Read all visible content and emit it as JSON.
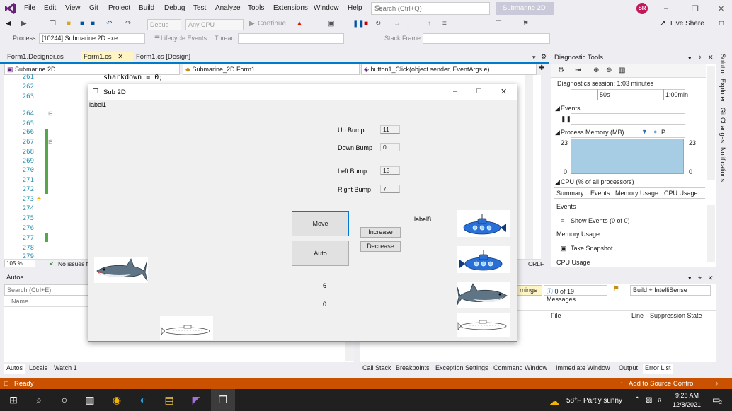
{
  "menu": [
    "File",
    "Edit",
    "View",
    "Git",
    "Project",
    "Build",
    "Debug",
    "Test",
    "Analyze",
    "Tools",
    "Extensions",
    "Window",
    "Help"
  ],
  "search": {
    "placeholder": "Search (Ctrl+Q)"
  },
  "solution_name": "Submarine 2D",
  "user_initials": "SR",
  "toolbar": {
    "config": "Debug",
    "platform": "Any CPU",
    "continue": "Continue",
    "live_share": "Live Share"
  },
  "toolbar2": {
    "process_label": "Process:",
    "process_value": "[10244] Submarine 2D.exe",
    "lifecycle": "Lifecycle Events",
    "thread_label": "Thread:",
    "stack_frame_label": "Stack Frame:"
  },
  "doc_tabs": [
    {
      "label": "Form1.Designer.cs"
    },
    {
      "label": "Form1.cs"
    },
    {
      "label": "Form1.cs [Design]"
    }
  ],
  "nav": {
    "project": "Submarine 2D",
    "class": "Submarine_2D.Form1",
    "member": "button1_Click(object sender, EventArgs e)"
  },
  "editor": {
    "code_line": "sharkdown = 0;",
    "line_numbers": [
      "261",
      "262",
      "263",
      "264",
      "265",
      "266",
      "267",
      "268",
      "269",
      "270",
      "271",
      "272",
      "273",
      "274",
      "275",
      "276",
      "277",
      "278",
      "279"
    ],
    "zoom": "105 %",
    "issues": "No issues f",
    "line_ending": "CRLF"
  },
  "diagnostics": {
    "title": "Diagnostic Tools",
    "session": "Diagnostics session: 1:03 minutes",
    "tick1": "50s",
    "tick2": "1:00min",
    "events_label": "Events",
    "memory_label": "Process Memory (MB)",
    "memory_legend": "P.",
    "mem_max_left": "23",
    "mem_max_right": "23",
    "mem_min_left": "0",
    "mem_min_right": "0",
    "cpu_label": "CPU (% of all processors)",
    "tabs": [
      "Summary",
      "Events",
      "Memory Usage",
      "CPU Usage"
    ],
    "sec_events": "Events",
    "show_events": "Show Events (0 of 0)",
    "sec_memory": "Memory Usage",
    "take_snapshot": "Take Snapshot",
    "sec_cpu": "CPU Usage"
  },
  "side_tabs": [
    "Solution Explorer",
    "Git Changes",
    "Notifications"
  ],
  "autos": {
    "title": "Autos",
    "search": "Search (Ctrl+E)",
    "col_name": "Name"
  },
  "errlist": {
    "warnings": "rnings",
    "messages": "0 of 19 Messages",
    "build_filter": "Build + IntelliSense",
    "col_file": "File",
    "col_line": "Line",
    "col_suppression": "Suppression State"
  },
  "bottom_tabs_left": [
    "Autos",
    "Locals",
    "Watch 1"
  ],
  "bottom_tabs_right": [
    "Call Stack",
    "Breakpoints",
    "Exception Settings",
    "Command Window",
    "Immediate Window",
    "Output",
    "Error List"
  ],
  "status": {
    "ready": "Ready",
    "source_control": "Add to Source Control"
  },
  "taskbar": {
    "weather": "58°F  Partly sunny",
    "time": "9:28 AM",
    "date": "12/8/2021",
    "notifications": "2"
  },
  "form": {
    "title": "Sub 2D",
    "label1": "label1",
    "up_bump_label": "Up Bump",
    "up_bump_value": "11",
    "down_bump_label": "Down Bump",
    "down_bump_value": "0",
    "left_bump_label": "Left Bump",
    "left_bump_value": "13",
    "right_bump_label": "Right Bump",
    "right_bump_value": "7",
    "move_button": "Move",
    "auto_button": "Auto",
    "increase_button": "Increase",
    "decrease_button": "Decrease",
    "label8": "label8",
    "value_a": "6",
    "value_b": "0"
  },
  "colors": {
    "accent": "#007acc",
    "status_bar": "#ca5100",
    "memory_fill": "#a6cde3",
    "avatar": "#c2185b"
  }
}
